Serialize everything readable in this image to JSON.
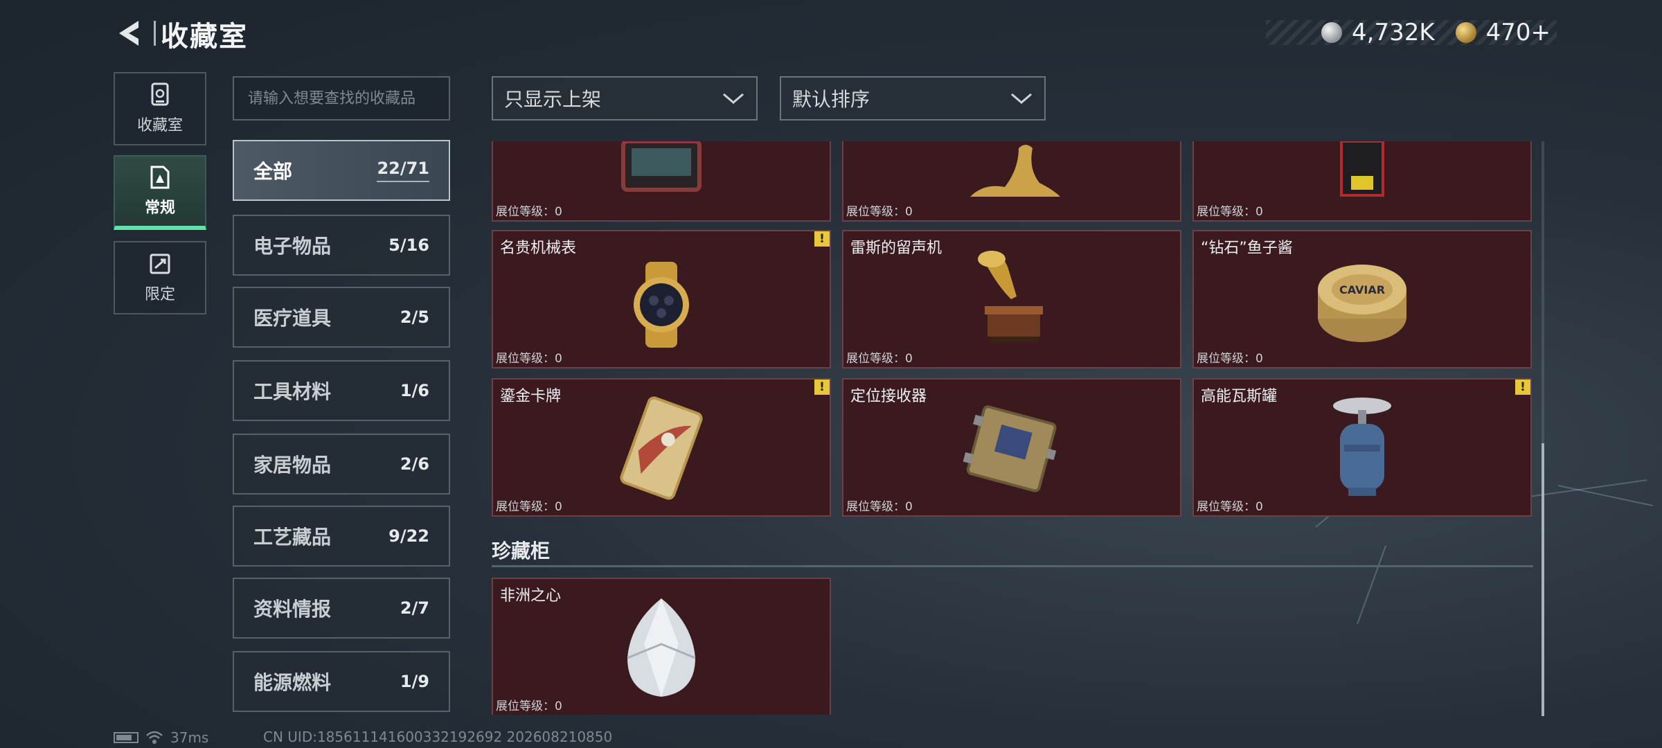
{
  "header": {
    "title": "收藏室",
    "currency": [
      {
        "icon": "silver-coin-icon",
        "value": "4,732K"
      },
      {
        "icon": "gold-coin-icon",
        "value": "470+"
      }
    ]
  },
  "rail": [
    {
      "label": "收藏室",
      "icon": "collection-room-icon"
    },
    {
      "label": "常规",
      "icon": "regular-icon",
      "active": true
    },
    {
      "label": "限定",
      "icon": "limited-icon"
    }
  ],
  "search": {
    "placeholder": "请输入想要查找的收藏品"
  },
  "categories": [
    {
      "name": "全部",
      "count": "22/71",
      "active": true
    },
    {
      "name": "电子物品",
      "count": "5/16"
    },
    {
      "name": "医疗道具",
      "count": "2/5"
    },
    {
      "name": "工具材料",
      "count": "1/6"
    },
    {
      "name": "家居物品",
      "count": "2/6"
    },
    {
      "name": "工艺藏品",
      "count": "9/22"
    },
    {
      "name": "资料情报",
      "count": "2/7"
    },
    {
      "name": "能源燃料",
      "count": "1/9"
    }
  ],
  "filters": {
    "display": "只显示上架",
    "sort": "默认排序"
  },
  "level_label": "展位等级：",
  "grid": {
    "row0": [
      {
        "name": "",
        "level": "0",
        "warn": false
      },
      {
        "name": "",
        "level": "0",
        "warn": false
      },
      {
        "name": "",
        "level": "0",
        "warn": false
      }
    ],
    "row1": [
      {
        "name": "名贵机械表",
        "level": "0",
        "warn": true
      },
      {
        "name": "雷斯的留声机",
        "level": "0",
        "warn": false
      },
      {
        "name": "“钻石”鱼子酱",
        "level": "0",
        "warn": false
      }
    ],
    "row2": [
      {
        "name": "鎏金卡牌",
        "level": "0",
        "warn": true
      },
      {
        "name": "定位接收器",
        "level": "0",
        "warn": false
      },
      {
        "name": "高能瓦斯罐",
        "level": "0",
        "warn": true
      }
    ]
  },
  "treasure": {
    "title": "珍藏柜",
    "items": [
      {
        "name": "非洲之心",
        "level": "0"
      }
    ]
  },
  "warn_glyph": "!",
  "caviar_text": "CAVIAR",
  "footer": {
    "ping": "37ms",
    "uid": "CN UID:185611141600332192692 202608210850"
  }
}
